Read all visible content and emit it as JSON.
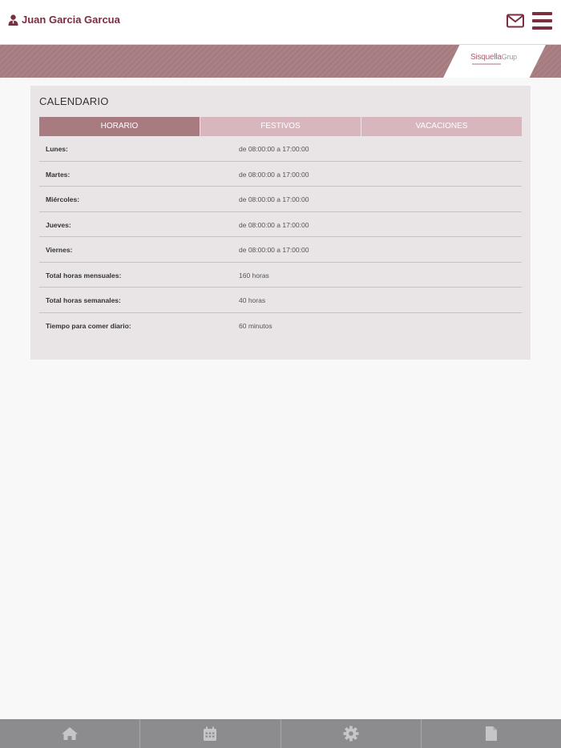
{
  "header": {
    "user_name": "Juan Garcia Garcua",
    "user_icon": "user-icon",
    "mail_icon": "mail-icon",
    "menu_icon": "hamburger-menu-icon"
  },
  "logo": {
    "brand": "Sisquella",
    "suffix": "Grup"
  },
  "calendar": {
    "title": "CALENDARIO",
    "tabs": [
      {
        "label": "HORARIO",
        "active": true
      },
      {
        "label": "FESTIVOS",
        "active": false
      },
      {
        "label": "VACACIONES",
        "active": false
      }
    ],
    "rows": [
      {
        "label": "Lunes:",
        "value": "de 08:00:00 a 17:00:00"
      },
      {
        "label": "Martes:",
        "value": "de 08:00:00 a 17:00:00"
      },
      {
        "label": "Miércoles:",
        "value": "de 08:00:00 a 17:00:00"
      },
      {
        "label": "Jueves:",
        "value": "de 08:00:00 a 17:00:00"
      },
      {
        "label": "Viernes:",
        "value": "de 08:00:00 a 17:00:00"
      },
      {
        "label": "Total horas mensuales:",
        "value": "160 horas"
      },
      {
        "label": "Total horas semanales:",
        "value": "40 horas"
      },
      {
        "label": "Tiempo para comer diario:",
        "value": "60 minutos"
      }
    ]
  },
  "bottom_nav": [
    {
      "icon": "home-icon"
    },
    {
      "icon": "calendar-icon"
    },
    {
      "icon": "gear-icon"
    },
    {
      "icon": "document-icon"
    }
  ],
  "colors": {
    "brand": "#7a2e3f",
    "banner": "#a67b80",
    "tab_active": "#a87b80",
    "tab_inactive": "#d7b7bd",
    "card_bg": "#e9e4e5",
    "nav_bg": "#8c8c8e"
  }
}
